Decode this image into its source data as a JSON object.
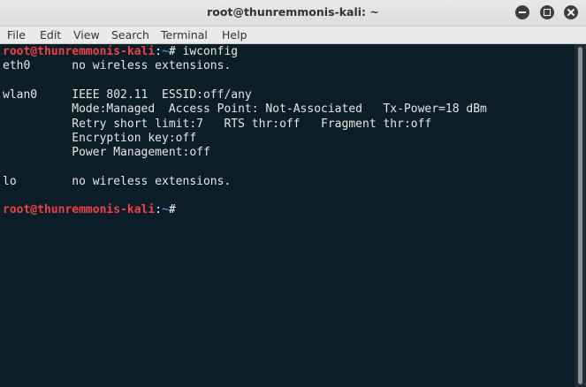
{
  "window": {
    "title": "root@thunremmonis-kali: ~"
  },
  "menu": {
    "file": "File",
    "edit": "Edit",
    "view": "View",
    "search": "Search",
    "terminal": "Terminal",
    "help": "Help"
  },
  "prompt": {
    "user_host": "root@thunremmonis-kali",
    "colon": ":",
    "path": "~",
    "symbol": "# "
  },
  "command": "iwconfig",
  "output": [
    "eth0      no wireless extensions.",
    "",
    "wlan0     IEEE 802.11  ESSID:off/any",
    "          Mode:Managed  Access Point: Not-Associated   Tx-Power=18 dBm",
    "          Retry short limit:7   RTS thr:off   Fragment thr:off",
    "          Encryption key:off",
    "          Power Management:off",
    "",
    "lo        no wireless extensions.",
    ""
  ],
  "colors": {
    "prompt_user": "#ee4047",
    "prompt_path": "#4a7fd6",
    "terminal_bg": "#0b1d27",
    "terminal_fg": "#e6e6e6"
  }
}
